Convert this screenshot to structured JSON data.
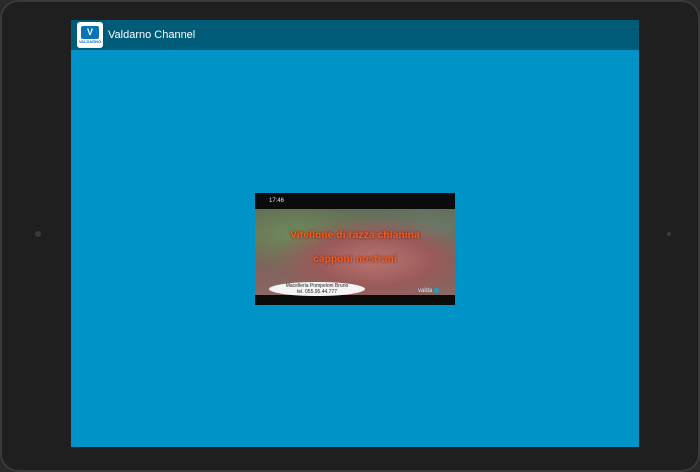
{
  "app": {
    "title": "Valdarno Channel",
    "icon_text": "V",
    "icon_subtext": "VALDARNO"
  },
  "video": {
    "clock": "17:46",
    "caption_line1": "Vitellone di razza chianina",
    "caption_line2": "capponi nostrani",
    "ad_line1": "Macelleria Pompeloni Bruno",
    "ad_line2": "tel. 055.95.44.777",
    "channel_bug": "valda"
  },
  "colors": {
    "screen_bg": "#0093c8",
    "actionbar_bg": "#005b78",
    "caption": "#ff5a1a"
  }
}
